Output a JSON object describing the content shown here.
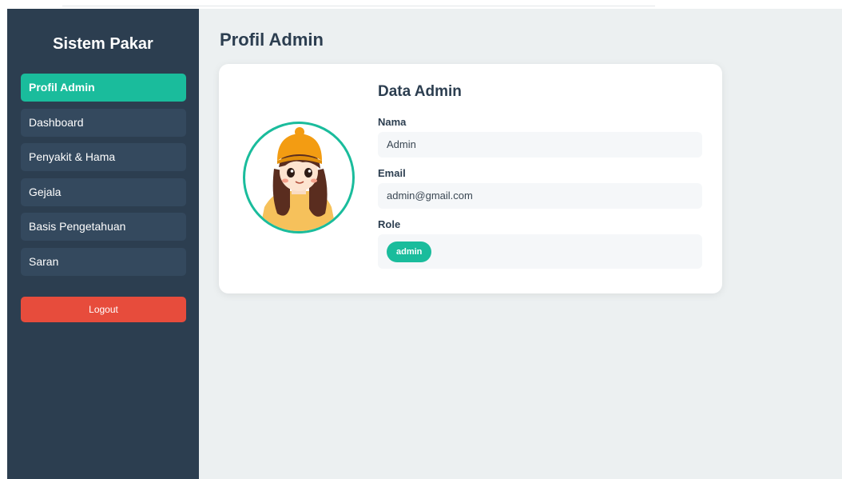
{
  "sidebar": {
    "brand": "Sistem Pakar",
    "items": [
      {
        "label": "Profil Admin",
        "active": true
      },
      {
        "label": "Dashboard",
        "active": false
      },
      {
        "label": "Penyakit & Hama",
        "active": false
      },
      {
        "label": "Gejala",
        "active": false
      },
      {
        "label": "Basis Pengetahuan",
        "active": false
      },
      {
        "label": "Saran",
        "active": false
      }
    ],
    "logout_label": "Logout"
  },
  "main": {
    "page_title": "Profil Admin",
    "card": {
      "title": "Data Admin",
      "fields": {
        "nama_label": "Nama",
        "nama_value": "Admin",
        "email_label": "Email",
        "email_value": "admin@gmail.com",
        "role_label": "Role",
        "role_value": "admin"
      }
    }
  },
  "colors": {
    "sidebar_bg": "#2c3e50",
    "nav_item_bg": "#34495e",
    "accent": "#1abc9c",
    "danger": "#e74c3c",
    "main_bg": "#ecf0f1"
  }
}
